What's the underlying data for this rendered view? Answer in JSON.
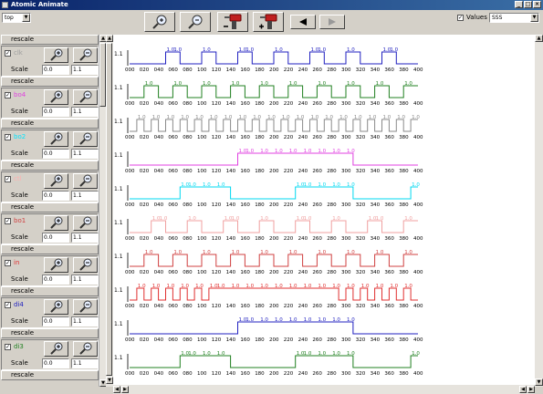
{
  "window": {
    "title": "Atomic Animate"
  },
  "toolbar": {
    "view_select": "top",
    "values_label": "Values",
    "values_checked": true,
    "unit_select": "SSS"
  },
  "panel": {
    "rescale_label": "rescale",
    "scale_label": "Scale",
    "signals": [
      {
        "name": "clk",
        "color": "#9e9e9e",
        "scale_min": "0.0",
        "scale_max": "1.1"
      },
      {
        "name": "bo4",
        "color": "#e040e0",
        "scale_min": "0.0",
        "scale_max": "1.1"
      },
      {
        "name": "bo2",
        "color": "#00e5ff",
        "scale_min": "0.0",
        "scale_max": "1.1"
      },
      {
        "name": "ctl",
        "color": "#ffb0b0",
        "scale_min": "0.0",
        "scale_max": "1.1"
      },
      {
        "name": "bo1",
        "color": "#d04040",
        "scale_min": "0.0",
        "scale_max": "1.1"
      },
      {
        "name": "in",
        "color": "#e03030",
        "scale_min": "0.0",
        "scale_max": "1.1"
      },
      {
        "name": "di4",
        "color": "#2020c0",
        "scale_min": "0.0",
        "scale_max": "1.1"
      },
      {
        "name": "di3",
        "color": "#208020",
        "scale_min": "0.0",
        "scale_max": "1.1"
      }
    ]
  },
  "plot": {
    "axis_max_label": "1.1",
    "rows": [
      {
        "color": "#2020c0",
        "ticks": [
          "000",
          "020",
          "040",
          "060",
          "080",
          "100",
          "120",
          "140",
          "160",
          "180",
          "200",
          "220",
          "240",
          "260",
          "280",
          "300",
          "320",
          "340",
          "360",
          "380",
          "400"
        ],
        "wave": [
          0,
          0,
          0,
          0,
          0,
          1,
          1,
          0,
          0,
          0,
          1,
          1,
          0,
          0,
          0,
          1,
          1,
          0,
          0,
          0,
          1,
          1,
          0,
          0,
          0,
          1,
          1,
          0,
          0,
          0,
          1,
          1,
          0,
          0,
          0,
          1,
          1,
          0,
          0,
          0
        ]
      },
      {
        "color": "#208020",
        "ticks": [
          "000",
          "020",
          "040",
          "060",
          "080",
          "100",
          "120",
          "140",
          "160",
          "180",
          "200",
          "220",
          "240",
          "260",
          "280",
          "300",
          "320",
          "340",
          "360",
          "380",
          "400"
        ],
        "wave": [
          0,
          0,
          1,
          1,
          0,
          0,
          1,
          1,
          0,
          0,
          1,
          1,
          0,
          0,
          1,
          1,
          0,
          0,
          1,
          1,
          0,
          0,
          1,
          1,
          0,
          0,
          1,
          1,
          0,
          0,
          1,
          1,
          0,
          0,
          1,
          1,
          0,
          0,
          1,
          1
        ]
      },
      {
        "color": "#8a8a8a",
        "ticks": [
          "000",
          "020",
          "040",
          "060",
          "080",
          "100",
          "120",
          "140",
          "160",
          "180",
          "200",
          "220",
          "240",
          "260",
          "280",
          "300",
          "320",
          "340",
          "360",
          "380",
          "400"
        ],
        "wave": [
          0,
          1,
          0,
          1,
          0,
          1,
          0,
          1,
          0,
          1,
          0,
          1,
          0,
          1,
          0,
          1,
          0,
          1,
          0,
          1,
          0,
          1,
          0,
          1,
          0,
          1,
          0,
          1,
          0,
          1,
          0,
          1,
          0,
          1,
          0,
          1,
          0,
          1,
          0,
          1
        ]
      },
      {
        "color": "#e040e0",
        "ticks": [
          "000",
          "020",
          "040",
          "060",
          "080",
          "100",
          "120",
          "140",
          "160",
          "180",
          "200",
          "220",
          "240",
          "260",
          "280",
          "300",
          "320",
          "340",
          "360",
          "380",
          "400"
        ],
        "wave": [
          0,
          0,
          0,
          0,
          0,
          0,
          0,
          0,
          0,
          0,
          0,
          0,
          0,
          0,
          0,
          1,
          1,
          1,
          1,
          1,
          1,
          1,
          1,
          1,
          1,
          1,
          1,
          1,
          1,
          1,
          1,
          0,
          0,
          0,
          0,
          0,
          0,
          0,
          0,
          0
        ]
      },
      {
        "color": "#00d8f0",
        "ticks": [
          "000",
          "020",
          "040",
          "060",
          "080",
          "100",
          "120",
          "140",
          "160",
          "180",
          "200",
          "220",
          "240",
          "260",
          "280",
          "300",
          "320",
          "340",
          "360",
          "380",
          "400"
        ],
        "wave": [
          0,
          0,
          0,
          0,
          0,
          0,
          0,
          1,
          1,
          1,
          1,
          1,
          1,
          1,
          0,
          0,
          0,
          0,
          0,
          0,
          0,
          0,
          0,
          1,
          1,
          1,
          1,
          1,
          1,
          1,
          1,
          0,
          0,
          0,
          0,
          0,
          0,
          0,
          0,
          1
        ]
      },
      {
        "color": "#f0a0a0",
        "ticks": [
          "000",
          "020",
          "040",
          "060",
          "080",
          "100",
          "120",
          "140",
          "160",
          "180",
          "200",
          "220",
          "240",
          "260",
          "280",
          "300",
          "320",
          "340",
          "360",
          "380",
          "400"
        ],
        "wave": [
          0,
          0,
          0,
          1,
          1,
          0,
          0,
          0,
          1,
          1,
          0,
          0,
          0,
          1,
          1,
          0,
          0,
          0,
          1,
          1,
          0,
          0,
          0,
          1,
          1,
          0,
          0,
          0,
          1,
          1,
          0,
          0,
          0,
          1,
          1,
          0,
          0,
          0,
          1,
          1
        ]
      },
      {
        "color": "#d04040",
        "ticks": [
          "000",
          "020",
          "040",
          "060",
          "080",
          "100",
          "120",
          "140",
          "160",
          "180",
          "200",
          "220",
          "240",
          "260",
          "280",
          "300",
          "320",
          "340",
          "360",
          "380",
          "400"
        ],
        "wave": [
          0,
          0,
          1,
          1,
          0,
          0,
          1,
          1,
          0,
          0,
          1,
          1,
          0,
          0,
          1,
          1,
          0,
          0,
          1,
          1,
          0,
          0,
          1,
          1,
          0,
          0,
          1,
          1,
          0,
          0,
          1,
          1,
          0,
          0,
          1,
          1,
          0,
          0,
          1,
          1
        ]
      },
      {
        "color": "#e03030",
        "ticks": [
          "000",
          "020",
          "040",
          "060",
          "080",
          "100",
          "120",
          "140",
          "160",
          "180",
          "200",
          "220",
          "240",
          "260",
          "280",
          "300",
          "320",
          "340",
          "360",
          "380",
          "400"
        ],
        "wave": [
          0,
          1,
          0,
          1,
          0,
          1,
          0,
          1,
          0,
          1,
          0,
          1,
          1,
          1,
          1,
          1,
          1,
          1,
          1,
          1,
          1,
          1,
          1,
          1,
          1,
          1,
          1,
          1,
          1,
          0,
          1,
          0,
          1,
          0,
          1,
          0,
          1,
          0,
          1,
          0
        ]
      },
      {
        "color": "#2020c0",
        "ticks": [
          "000",
          "020",
          "040",
          "060",
          "080",
          "100",
          "120",
          "140",
          "160",
          "180",
          "200",
          "220",
          "240",
          "260",
          "280",
          "300",
          "320",
          "340",
          "360",
          "380",
          "400"
        ],
        "wave": [
          0,
          0,
          0,
          0,
          0,
          0,
          0,
          0,
          0,
          0,
          0,
          0,
          0,
          0,
          0,
          1,
          1,
          1,
          1,
          1,
          1,
          1,
          1,
          1,
          1,
          1,
          1,
          1,
          1,
          1,
          1,
          0,
          0,
          0,
          0,
          0,
          0,
          0,
          0,
          0
        ]
      },
      {
        "color": "#208020",
        "ticks": [
          "000",
          "020",
          "040",
          "060",
          "080",
          "100",
          "120",
          "140",
          "160",
          "180",
          "200",
          "220",
          "240",
          "260",
          "280",
          "300",
          "320",
          "340",
          "360",
          "380",
          "400"
        ],
        "wave": [
          0,
          0,
          0,
          0,
          0,
          0,
          0,
          1,
          1,
          1,
          1,
          1,
          1,
          1,
          0,
          0,
          0,
          0,
          0,
          0,
          0,
          0,
          0,
          1,
          1,
          1,
          1,
          1,
          1,
          1,
          1,
          0,
          0,
          0,
          0,
          0,
          0,
          0,
          0,
          1
        ]
      }
    ]
  }
}
